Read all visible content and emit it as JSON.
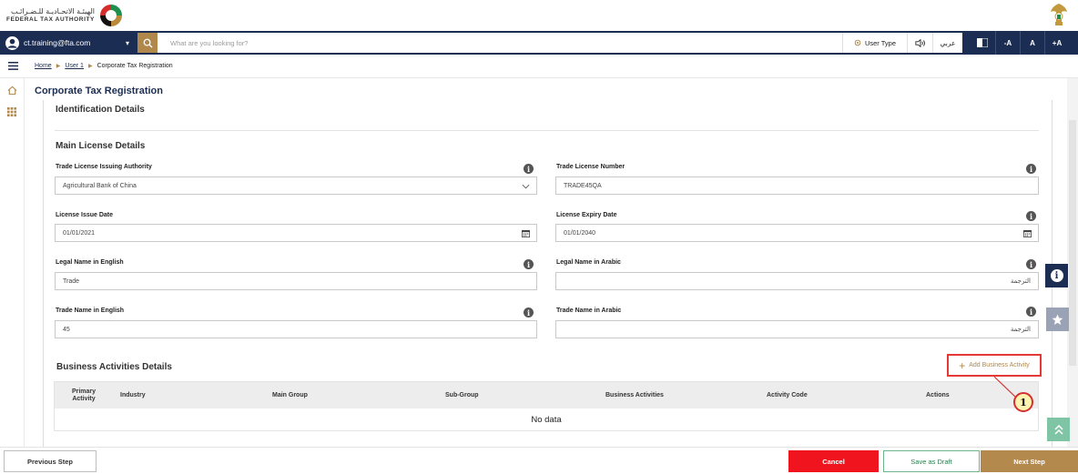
{
  "header": {
    "logo_ar": "الهيئـة الاتحـاديـة للـضـرائـب",
    "logo_en": "FEDERAL TAX AUTHORITY"
  },
  "navbar": {
    "user_email": "ct.training@fta.com",
    "search_placeholder": "What are you looking for?",
    "user_type": "User Type",
    "lang_toggle": "عربي",
    "font_decrease": "-A",
    "font_normal": "A",
    "font_increase": "+A"
  },
  "breadcrumb": {
    "home": "Home",
    "user": "User 1",
    "current": "Corporate Tax Registration"
  },
  "page": {
    "title": "Corporate Tax Registration"
  },
  "sections": {
    "identification": "Identification Details",
    "main_license": "Main License Details",
    "business_activities": "Business Activities Details"
  },
  "fields": {
    "trade_license_authority": {
      "label": "Trade License Issuing Authority",
      "value": "Agricultural Bank of China"
    },
    "trade_license_number": {
      "label": "Trade License Number",
      "value": "TRADE45QA"
    },
    "license_issue_date": {
      "label": "License Issue Date",
      "value": "01/01/2021"
    },
    "license_expiry_date": {
      "label": "License Expiry Date",
      "value": "01/01/2040"
    },
    "legal_name_en": {
      "label": "Legal Name in English",
      "value": "Trade"
    },
    "legal_name_ar": {
      "label": "Legal Name in Arabic",
      "value": "الترجمة"
    },
    "trade_name_en": {
      "label": "Trade Name in English",
      "value": "45"
    },
    "trade_name_ar": {
      "label": "Trade Name in Arabic",
      "value": "الترجمة"
    }
  },
  "activities": {
    "add_label": "Add Business Activity",
    "columns": [
      "Primary Activity",
      "Industry",
      "Main Group",
      "Sub-Group",
      "Business Activities",
      "Activity Code",
      "Actions"
    ],
    "empty_text": "No data"
  },
  "callout": {
    "number": "1"
  },
  "footer": {
    "previous": "Previous Step",
    "cancel": "Cancel",
    "save_draft": "Save as Draft",
    "next": "Next Step"
  },
  "colors": {
    "navy": "#1b2d52",
    "gold": "#b0884b",
    "cancel_red": "#f0141e",
    "callout_red": "#d32f2f"
  }
}
